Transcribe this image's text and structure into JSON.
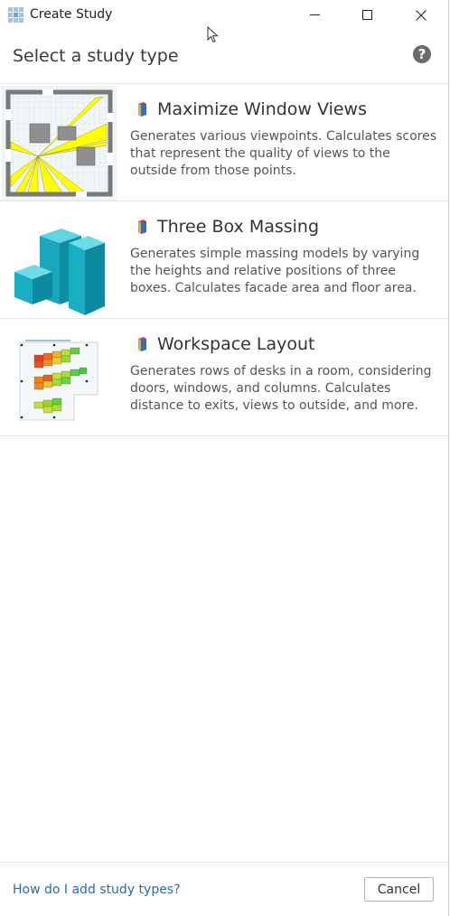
{
  "window": {
    "title": "Create Study",
    "controls": [
      "minimize-icon",
      "maximize-icon",
      "close-icon"
    ]
  },
  "header": {
    "title": "Select a study type",
    "help_icon": "?"
  },
  "studies": [
    {
      "title": "Maximize Window Views",
      "description": "Generates various viewpoints. Calculates scores that represent the quality of views to the outside from those points.",
      "thumbnail": "floor-plan-viewpoints-thumbnail"
    },
    {
      "title": "Three Box Massing",
      "description": "Generates simple massing models by varying the heights and relative positions of three boxes. Calculates facade area and floor area.",
      "thumbnail": "box-massing-thumbnail"
    },
    {
      "title": "Workspace Layout",
      "description": "Generates rows of desks in a room, considering doors, windows, and columns. Calculates distance to exits, views to outside, and more.",
      "thumbnail": "desk-layout-thumbnail"
    }
  ],
  "footer": {
    "help_link": "How do I add study types?",
    "cancel_label": "Cancel"
  },
  "colors": {
    "link": "#2a6ab2",
    "divider": "#e6e6e6",
    "massing": "#19b2c8",
    "viewcone": "#ffff00"
  }
}
